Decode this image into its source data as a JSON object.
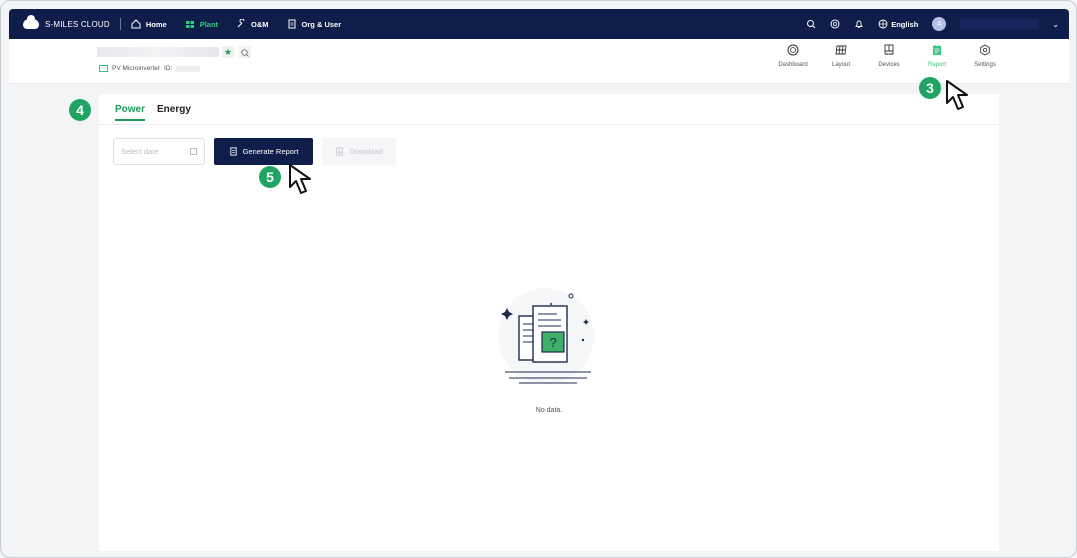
{
  "brand": {
    "name": "S-MILES CLOUD"
  },
  "topnav": {
    "items": [
      {
        "label": "Home",
        "icon": "home-icon",
        "active": false
      },
      {
        "label": "Plant",
        "icon": "plant-icon",
        "active": true
      },
      {
        "label": "O&M",
        "icon": "wrench-icon",
        "active": false
      },
      {
        "label": "Org & User",
        "icon": "document-icon",
        "active": false
      }
    ],
    "language": "English",
    "avatar_initial": "A"
  },
  "plant": {
    "type_label": "PV Microinverter",
    "id_label": "ID:",
    "tabs": [
      {
        "label": "Dashboard",
        "icon": "dashboard-icon"
      },
      {
        "label": "Layout",
        "icon": "layout-icon"
      },
      {
        "label": "Devices",
        "icon": "devices-icon"
      },
      {
        "label": "Report",
        "icon": "report-icon",
        "active": true
      },
      {
        "label": "Settings",
        "icon": "settings-icon"
      }
    ]
  },
  "report": {
    "tabs": [
      {
        "label": "Power",
        "active": true
      },
      {
        "label": "Energy",
        "active": false
      }
    ],
    "date_placeholder": "Select date",
    "generate_label": "Generate Report",
    "download_label": "Download",
    "empty_text": "No data."
  },
  "annotations": {
    "step3": "3",
    "step4": "4",
    "step5": "5"
  },
  "colors": {
    "nav_bg": "#0f1d4a",
    "accent": "#1e9a5c",
    "badge": "#1fa463"
  }
}
